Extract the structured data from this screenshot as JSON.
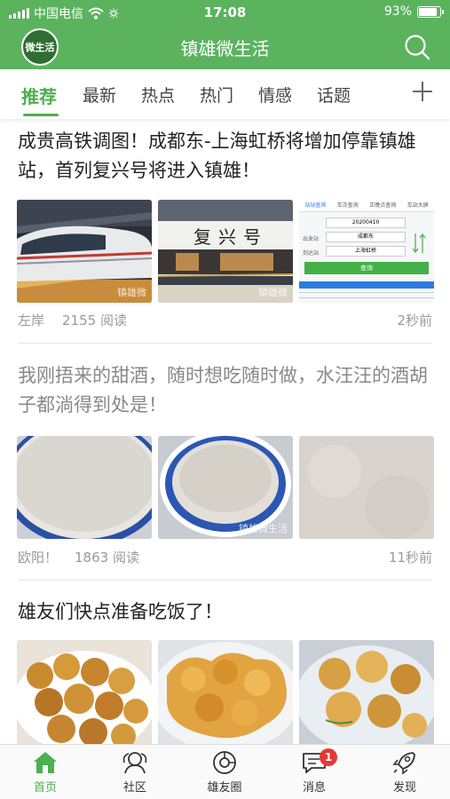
{
  "status_bar": {
    "carrier": "中国电信",
    "time": "17:08",
    "battery_percent": "93%",
    "battery_level": 0.93
  },
  "nav": {
    "logo_text": "微生活",
    "title": "镇雄微生活",
    "search_icon": "search-icon"
  },
  "tabs": [
    "推荐",
    "最新",
    "热点",
    "热门",
    "情感",
    "话题"
  ],
  "active_tab": 0,
  "articles": [
    {
      "title": "成贵高铁调图！成都东-上海虹桥将增加停靠镇雄站，首列复兴号将进入镇雄！",
      "author": "左岸",
      "reads": "2155 阅读",
      "time": "2秒前",
      "watermarks": [
        "镇雄微",
        "镇雄微"
      ],
      "ticket_form": {
        "tabs": [
          "站站查询",
          "车次查询",
          "正晚点查询",
          "车站大屏"
        ],
        "date": "20200410",
        "from_label": "出发站",
        "from": "成都东",
        "to_label": "到达站",
        "to": "上海虹桥",
        "button": "查询",
        "train_no": "复兴号"
      }
    },
    {
      "title": "我刚捂来的甜酒，随时想吃随时做，水汪汪的酒胡子都淌得到处是！",
      "author": "欧阳！",
      "reads": "1863 阅读",
      "time": "11秒前",
      "watermarks": [
        "镇雄微生活"
      ]
    },
    {
      "title": "雄友们快点准备吃饭了！"
    }
  ],
  "tabbar": [
    {
      "label": "首页",
      "icon": "home-icon"
    },
    {
      "label": "社区",
      "icon": "community-icon"
    },
    {
      "label": "雄友圈",
      "icon": "moments-icon"
    },
    {
      "label": "消息",
      "icon": "message-icon",
      "badge": "1"
    },
    {
      "label": "发现",
      "icon": "rocket-icon"
    }
  ],
  "colors": {
    "brand": "#5bb35e",
    "accent": "#4caf50",
    "badge": "#e53935"
  }
}
